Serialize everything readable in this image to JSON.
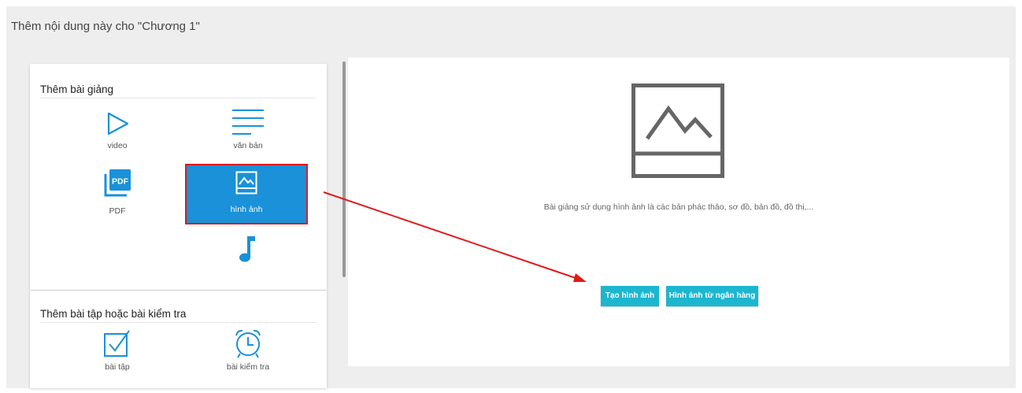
{
  "dialog": {
    "title": "Thêm nội dung này cho \"Chương 1\"",
    "close_glyph": "×"
  },
  "lecture_section": {
    "title": "Thêm bài giảng",
    "items": [
      {
        "label": "video",
        "icon": "play-triangle-icon"
      },
      {
        "label": "văn bản",
        "icon": "text-lines-icon"
      },
      {
        "label": "PDF",
        "icon": "pdf-icon",
        "icon_text": "PDF"
      },
      {
        "label": "hình ảnh",
        "icon": "image-icon",
        "selected": true
      },
      {
        "label": "",
        "icon": "music-note-icon"
      }
    ]
  },
  "exercise_section": {
    "title": "Thêm bài tập hoặc bài kiểm tra",
    "items": [
      {
        "label": "bài tập",
        "icon": "checkbox-icon"
      },
      {
        "label": "bài kiểm tra",
        "icon": "alarm-clock-icon"
      }
    ]
  },
  "panel": {
    "icon": "large-image-icon",
    "description": "Bài giảng sử dụng hình ảnh là các bản phác thảo, sơ đồ, bản đồ, đồ thị,...",
    "buttons": {
      "create": "Tạo hình ảnh",
      "bank": "Hình ảnh từ ngân hàng"
    }
  },
  "colors": {
    "accent_blue": "#1a91d8",
    "button_teal": "#1cb6cf",
    "highlight_red": "#e11919",
    "icon_blue": "#1a91d8"
  }
}
